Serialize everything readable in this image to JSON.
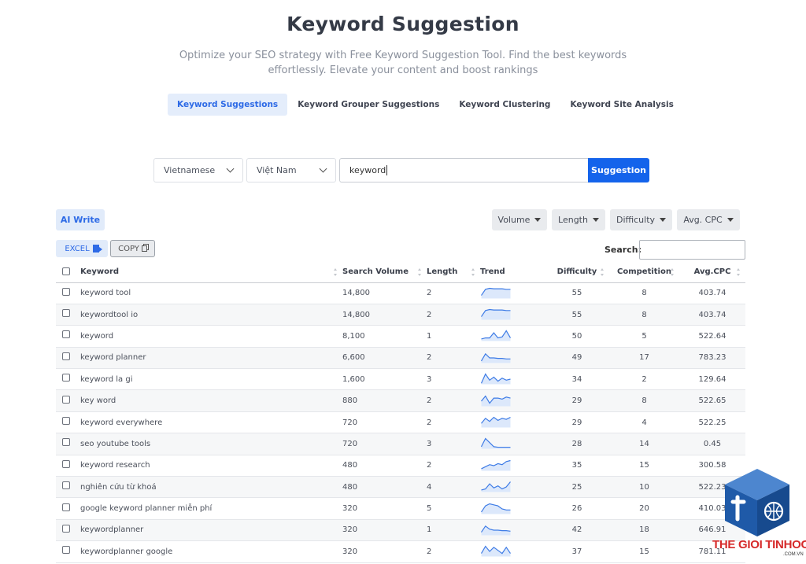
{
  "header": {
    "title": "Keyword Suggestion",
    "subtitle": "Optimize your SEO strategy with Free Keyword Suggestion Tool. Find the best keywords effortlessly. Elevate your content and boost rankings"
  },
  "tabs": [
    {
      "label": "Keyword Suggestions",
      "active": true
    },
    {
      "label": "Keyword Grouper Suggestions",
      "active": false
    },
    {
      "label": "Keyword Clustering",
      "active": false
    },
    {
      "label": "Keyword Site Analysis",
      "active": false
    }
  ],
  "search": {
    "language": "Vietnamese",
    "country": "Việt Nam",
    "keyword_value": "keyword",
    "button_label": "Suggestion"
  },
  "toolbar": {
    "ai_write_label": "AI Write",
    "filters": [
      "Volume",
      "Length",
      "Difficulty",
      "Avg. CPC"
    ],
    "excel_label": "EXCEL",
    "copy_label": "COPY",
    "search_label": "Search:"
  },
  "table": {
    "columns": [
      "Keyword",
      "Search Volume",
      "Length",
      "Trend",
      "Difficulty",
      "Competition",
      "Avg.CPC"
    ],
    "rows": [
      {
        "keyword": "keyword tool",
        "volume": "14,800",
        "length": "2",
        "difficulty": "55",
        "competition": "8",
        "cpc": "403.74",
        "trend": [
          0.3,
          0.9,
          1.0,
          0.95,
          0.95,
          0.95,
          0.9,
          0.9
        ]
      },
      {
        "keyword": "keywordtool io",
        "volume": "14,800",
        "length": "2",
        "difficulty": "55",
        "competition": "8",
        "cpc": "403.74",
        "trend": [
          0.3,
          0.9,
          1.0,
          0.95,
          0.95,
          0.95,
          0.9,
          0.9
        ]
      },
      {
        "keyword": "keyword",
        "volume": "8,100",
        "length": "1",
        "difficulty": "50",
        "competition": "5",
        "cpc": "522.64",
        "trend": [
          0.2,
          0.3,
          0.3,
          0.8,
          0.3,
          0.4,
          1.0,
          0.3
        ]
      },
      {
        "keyword": "keyword planner",
        "volume": "6,600",
        "length": "2",
        "difficulty": "49",
        "competition": "17",
        "cpc": "783.23",
        "trend": [
          0.2,
          0.9,
          0.5,
          0.5,
          0.45,
          0.45,
          0.4,
          0.4
        ]
      },
      {
        "keyword": "keyword la gi",
        "volume": "1,600",
        "length": "3",
        "difficulty": "34",
        "competition": "2",
        "cpc": "129.64",
        "trend": [
          0.1,
          1.0,
          0.4,
          0.7,
          0.3,
          0.6,
          0.4,
          0.5
        ]
      },
      {
        "keyword": "key word",
        "volume": "880",
        "length": "2",
        "difficulty": "29",
        "competition": "8",
        "cpc": "522.65",
        "trend": [
          0.5,
          1.0,
          0.3,
          0.8,
          0.8,
          0.7,
          0.9,
          0.8
        ]
      },
      {
        "keyword": "keyword everywhere",
        "volume": "720",
        "length": "2",
        "difficulty": "29",
        "competition": "4",
        "cpc": "522.25",
        "trend": [
          0.4,
          0.9,
          0.6,
          1.0,
          0.7,
          0.9,
          0.8,
          1.0
        ]
      },
      {
        "keyword": "seo youtube tools",
        "volume": "720",
        "length": "3",
        "difficulty": "28",
        "competition": "14",
        "cpc": "0.45",
        "trend": [
          0.2,
          1.0,
          0.6,
          0.2,
          0.15,
          0.15,
          0.15,
          0.15
        ]
      },
      {
        "keyword": "keyword research",
        "volume": "480",
        "length": "2",
        "difficulty": "35",
        "competition": "15",
        "cpc": "300.58",
        "trend": [
          0.2,
          0.4,
          0.6,
          0.5,
          0.7,
          0.6,
          0.9,
          1.0
        ]
      },
      {
        "keyword": "nghiên cứu từ khoá",
        "volume": "480",
        "length": "4",
        "difficulty": "25",
        "competition": "10",
        "cpc": "522.23",
        "trend": [
          0.2,
          0.3,
          0.8,
          0.4,
          0.6,
          0.3,
          0.5,
          1.0
        ]
      },
      {
        "keyword": "google keyword planner miễn phí",
        "volume": "320",
        "length": "5",
        "difficulty": "26",
        "competition": "20",
        "cpc": "410.03",
        "trend": [
          0.2,
          0.8,
          1.0,
          0.9,
          0.8,
          0.5,
          0.4,
          0.4
        ]
      },
      {
        "keyword": "keywordplanner",
        "volume": "320",
        "length": "1",
        "difficulty": "42",
        "competition": "18",
        "cpc": "646.91",
        "trend": [
          0.3,
          0.9,
          0.6,
          0.5,
          0.5,
          0.45,
          0.45,
          0.4
        ]
      },
      {
        "keyword": "keywordplanner google",
        "volume": "320",
        "length": "2",
        "difficulty": "37",
        "competition": "15",
        "cpc": "781.11",
        "trend": [
          0.3,
          1.0,
          0.5,
          0.9,
          0.6,
          0.3,
          0.9,
          0.3
        ]
      }
    ]
  },
  "watermark": {
    "brand": "THE GIOI TINHOC",
    "domain": ".COM.VN"
  },
  "colors": {
    "accent": "#1463eb",
    "accent_light": "#e1ebfa",
    "trend_line": "#3d7be6",
    "trend_fill": "#dce8fb",
    "brand_red": "#d62a2a",
    "logo_blue": "#1f5aa8"
  }
}
